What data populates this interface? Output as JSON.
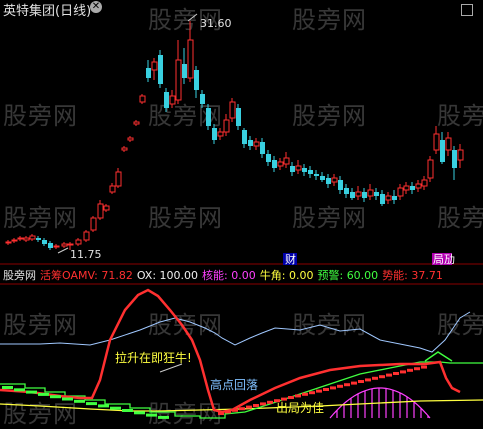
{
  "window": {
    "title": "英特集团(日线)"
  },
  "watermark": "股旁网",
  "price_chart": {
    "high_label": "31.60",
    "low_label": "11.75",
    "badge_cai": "财",
    "badge_ju": "局劢"
  },
  "indicator": {
    "name": "股旁网",
    "huochou_label": "活筹OAMV:",
    "huochou_value": "71.82",
    "ox_label": "OX:",
    "ox_value": "100.00",
    "heneng_label": "核能:",
    "heneng_value": "0.00",
    "niujiao_label": "牛角:",
    "niujiao_value": "0.00",
    "yujing_label": "预警:",
    "yujing_value": "60.00",
    "shineng_label": "势能:",
    "shineng_value": "37.71",
    "annotation_lasheng": "拉升在即狂牛!",
    "annotation_gaodian": "高点回落",
    "annotation_chuju": "出局为佳"
  },
  "colors": {
    "up": "#ff3030",
    "down": "#39d0e0",
    "huochou": "#ff3030",
    "ox": "#f0f0f0",
    "heneng": "#ff40ff",
    "niujiao": "#ffff40",
    "yujing": "#40ff40",
    "shineng": "#ff3030"
  }
}
